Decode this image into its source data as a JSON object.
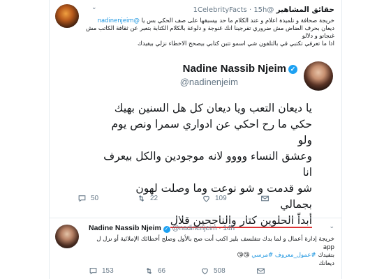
{
  "tweet1": {
    "name": "حقائق المشاهير",
    "handle": "@1CelebrityFacts",
    "time": "15h",
    "mention": "@nadinenjeim",
    "lines": [
      "خريجة صحافة و تلميذة اعلام و عند الكلام ما حد بيسبقها على صف الحكي بس يا",
      "ديعان بحرف الضاض مش ضروري تفرجينا انك غنوجة و دلوعة بالكلام الكتابة بتعبر عن ثقافة الكاتب مش",
      "غنجاتو و دلالو",
      "اذا ما تعرفي تكتبي في بالتلفون شي اسمو تتبن كتابي بيصحح الاخطاء نزلي بيفيدك"
    ]
  },
  "embedded": {
    "name": "Nadine Nassib Njeim",
    "verified": "✓",
    "handle": "@nadinenjeim",
    "lines": [
      "يا ديعان التعب ويا ديعان كل هل السنين بهيك",
      "حكي ما رح احكي عن ادواري سمرا ونص يوم ولو",
      "وعشق النساء وووو لانه موجودين والكل بيعرف انا",
      "شو قدمت و شو نوعت وما وصلت لهون بجمالي",
      "أبداً الحلوين كتار والناجحين قلال"
    ]
  },
  "tweet1_actions": {
    "reply_count": "50",
    "retweet_count": "22",
    "like_count": "109"
  },
  "tweet2": {
    "name": "Nadine Nassib Njeim",
    "verified": "✓",
    "handle": "@nadinenjeim",
    "time": "14h",
    "line1": "خريجة إدارة أعمال و لما بدك تتفلسف بليز اكتب أنت صح بالأول وصلح أخطائك الإملائية أو نزل ل app",
    "line2_prefix": "بتفيدك ",
    "hashtags": "#عمول_معروف #مرسي",
    "emoji": "😘😘",
    "line3": "ديعانك",
    "reply_count": "153",
    "retweet_count": "66",
    "like_count": "508"
  },
  "colors": {
    "link_blue": "#1b95e0",
    "verified_blue": "#1da1f2",
    "gray_text": "#657786",
    "like_red": "#e0245e",
    "underline_red": "#d33"
  },
  "icons": [
    "chevron-down-icon",
    "verified-badge-icon",
    "reply-icon",
    "retweet-icon",
    "like-icon",
    "mail-icon"
  ]
}
